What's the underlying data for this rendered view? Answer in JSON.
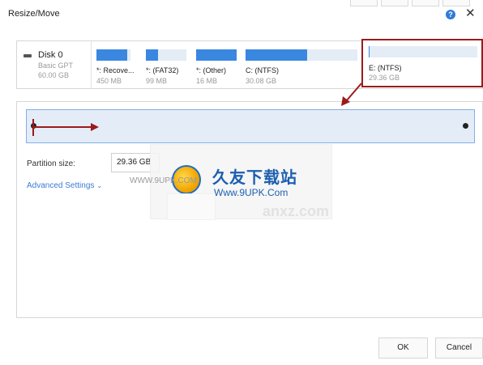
{
  "window": {
    "title": "Resize/Move",
    "help_icon": "?",
    "close_icon": "✕"
  },
  "disk": {
    "name": "Disk 0",
    "type": "Basic GPT",
    "size": "60.00 GB"
  },
  "partitions": [
    {
      "label": "*: Recove...",
      "size": "450 MB",
      "used_fraction": 0.9
    },
    {
      "label": "*: (FAT32)",
      "size": "99 MB",
      "used_fraction": 0.3
    },
    {
      "label": "*: (Other)",
      "size": "16 MB",
      "used_fraction": 1.0
    },
    {
      "label": "C: (NTFS)",
      "size": "30.08 GB",
      "used_fraction": 0.55
    }
  ],
  "selected_partition": {
    "label": "E: (NTFS)",
    "size": "29.36 GB"
  },
  "form": {
    "partition_size_label": "Partition size:",
    "partition_size_value": "29.36 GB",
    "advanced_settings": "Advanced Settings",
    "advanced_chevron": "⌄"
  },
  "watermark": {
    "brand_cn": "久友下载站",
    "url": "Www.9UPK.Com",
    "small": "WWW.9UPK.COM",
    "faint": "anxz.com"
  },
  "buttons": {
    "ok": "OK",
    "cancel": "Cancel"
  },
  "colors": {
    "accent": "#3a87e0",
    "annotation": "#9b1b1b",
    "link": "#3a7bd5"
  }
}
